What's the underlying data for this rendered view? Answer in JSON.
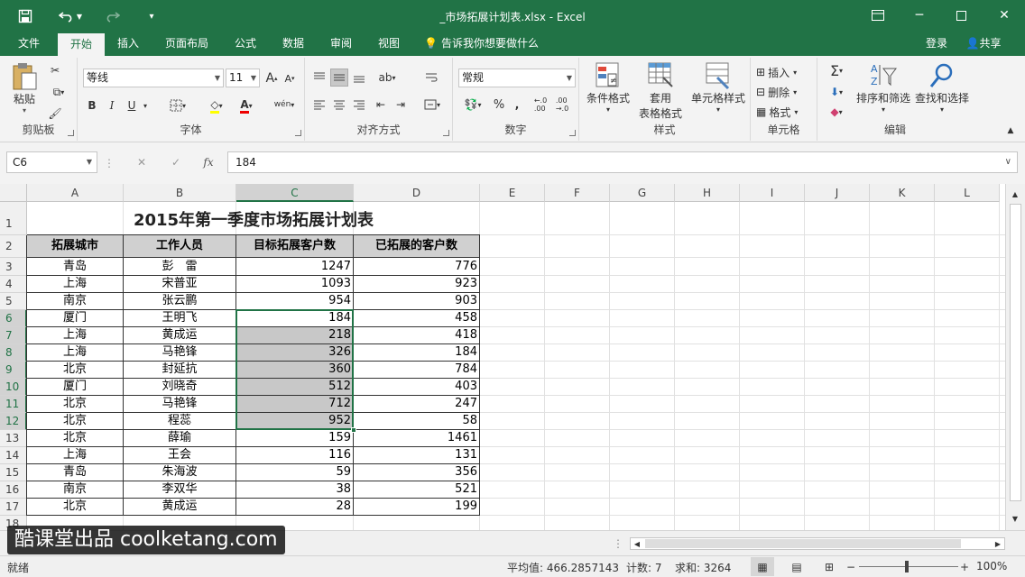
{
  "window": {
    "title": "_市场拓展计划表.xlsx - Excel"
  },
  "menu": {
    "tabs": [
      "文件",
      "开始",
      "插入",
      "页面布局",
      "公式",
      "数据",
      "审阅",
      "视图"
    ],
    "tell_me": "告诉我你想要做什么",
    "login": "登录",
    "share": "共享"
  },
  "ribbon": {
    "clipboard": {
      "label": "剪贴板",
      "paste": "粘贴"
    },
    "font": {
      "label": "字体",
      "name": "等线",
      "size": "11",
      "bold": "B",
      "italic": "I",
      "underline": "U"
    },
    "alignment": {
      "label": "对齐方式"
    },
    "number": {
      "label": "数字",
      "format": "常规",
      "percent": "%"
    },
    "styles": {
      "label": "样式",
      "conditional": "条件格式",
      "table_fmt_1": "套用",
      "table_fmt_2": "表格格式",
      "cell_styles": "单元格样式"
    },
    "cells": {
      "label": "单元格",
      "insert": "插入",
      "delete": "删除",
      "format": "格式"
    },
    "editing": {
      "label": "编辑",
      "sort": "排序和筛选",
      "find": "查找和选择"
    }
  },
  "formula_bar": {
    "name_box": "C6",
    "fx": "fx",
    "value": "184"
  },
  "columns": [
    "A",
    "B",
    "C",
    "D",
    "E",
    "F",
    "G",
    "H",
    "I",
    "J",
    "K",
    "L"
  ],
  "sheet": {
    "title": "2015年第一季度市场拓展计划表",
    "headers": [
      "拓展城市",
      "工作人员",
      "目标拓展客户数",
      "已拓展的客户数"
    ],
    "rows": [
      [
        "青岛",
        "彭　雷",
        "1247",
        "776"
      ],
      [
        "上海",
        "宋普亚",
        "1093",
        "923"
      ],
      [
        "南京",
        "张云鹏",
        "954",
        "903"
      ],
      [
        "厦门",
        "王明飞",
        "184",
        "458"
      ],
      [
        "上海",
        "黄成运",
        "218",
        "418"
      ],
      [
        "上海",
        "马艳锋",
        "326",
        "184"
      ],
      [
        "北京",
        "封延抗",
        "360",
        "784"
      ],
      [
        "厦门",
        "刘晓奇",
        "512",
        "403"
      ],
      [
        "北京",
        "马艳锋",
        "712",
        "247"
      ],
      [
        "北京",
        "程蕊",
        "952",
        "58"
      ],
      [
        "北京",
        "薛瑜",
        "159",
        "1461"
      ],
      [
        "上海",
        "王会",
        "116",
        "131"
      ],
      [
        "青岛",
        "朱海波",
        "59",
        "356"
      ],
      [
        "南京",
        "李双华",
        "38",
        "521"
      ],
      [
        "北京",
        "黄成运",
        "28",
        "199"
      ]
    ]
  },
  "row_numbers": [
    "1",
    "2",
    "3",
    "4",
    "5",
    "6",
    "7",
    "8",
    "9",
    "10",
    "11",
    "12",
    "13",
    "14",
    "15",
    "16",
    "17",
    "18"
  ],
  "status": {
    "ready": "就绪",
    "average": "平均值: 466.2857143",
    "count": "计数: 7",
    "sum": "求和: 3264",
    "zoom": "100%"
  },
  "watermark": "酷课堂出品 coolketang.com",
  "colors": {
    "excel_green": "#217346",
    "selection": "#c8c8c8"
  }
}
